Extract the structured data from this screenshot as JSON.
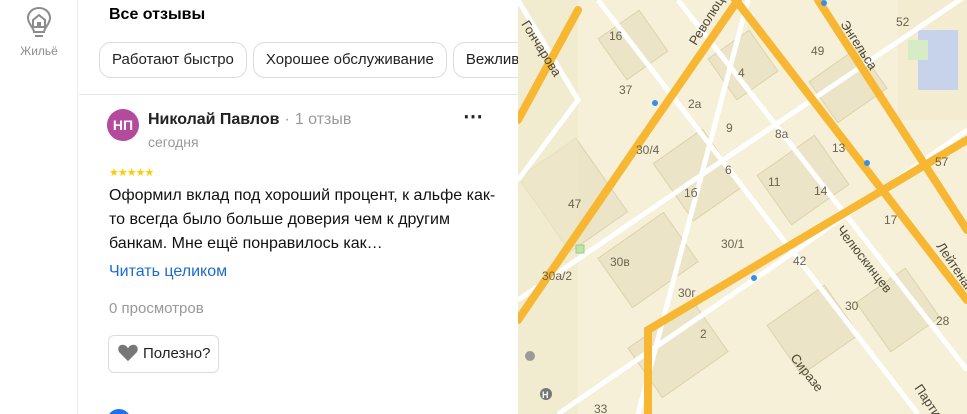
{
  "rail": {
    "item_label": "Жильё",
    "icon": "house-pin-icon"
  },
  "reviews": {
    "title": "Все отзывы",
    "chips": [
      "Работают быстро",
      "Хорошее обслуживание",
      "Вежливые сотрудники"
    ],
    "items": [
      {
        "avatar_initials": "НП",
        "avatar_color": "#b34a9c",
        "author": "Николай Павлов",
        "author_reviews": "1 отзыв",
        "date": "сегодня",
        "rating": 5,
        "stars": "★★★★★",
        "text": "Оформил вклад под хороший процент, к альфе как-то всегда было больше доверия чем к другим банкам. Мне ещё понравилось как…",
        "read_more": "Читать целиком",
        "views": "0 просмотров",
        "helpful_label": "Полезно?"
      }
    ]
  },
  "map": {
    "streets": [
      "Революционная",
      "Энгельса",
      "Гончарова",
      "Челюскинцев",
      "Лейтенанта",
      "Сиразе",
      "Партиз"
    ],
    "house_numbers": [
      "52",
      "16",
      "49",
      "4",
      "37",
      "2а",
      "9",
      "8а",
      "13",
      "30/4",
      "6",
      "11",
      "57",
      "1б",
      "14",
      "47",
      "17",
      "30/1",
      "30в",
      "42",
      "30а/2",
      "30г",
      "30",
      "2",
      "28",
      "33"
    ]
  },
  "colors": {
    "accent": "#1a6bd0",
    "road": "#f7b733",
    "map_bg": "#f6f0d8"
  }
}
